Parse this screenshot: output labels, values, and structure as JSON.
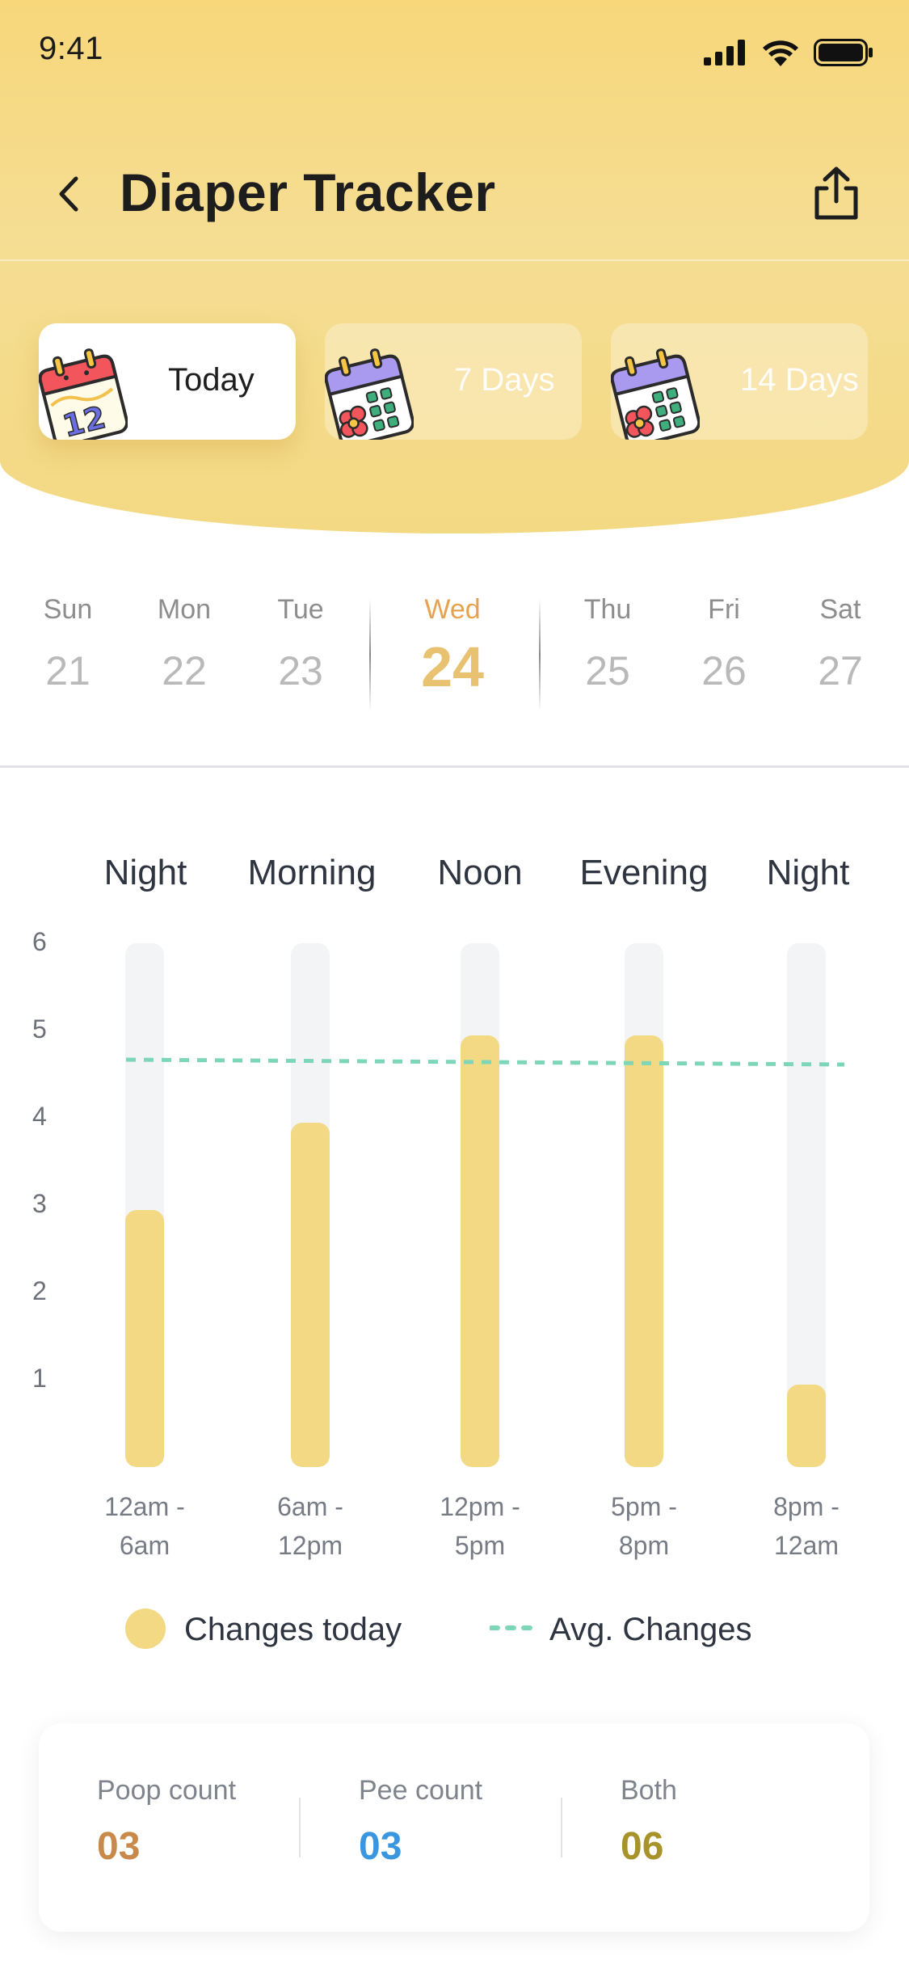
{
  "status_bar": {
    "time": "9:41",
    "icons": [
      "signal-icon",
      "wifi-icon",
      "battery-icon"
    ]
  },
  "header": {
    "title": "Diaper Tracker",
    "back_icon": "chevron-left-icon",
    "share_icon": "share-icon"
  },
  "range_tabs": [
    {
      "label": "Today",
      "active": true,
      "icon": "calendar-today-icon"
    },
    {
      "label": "7 Days",
      "active": false,
      "icon": "calendar-flower-icon"
    },
    {
      "label": "14 Days",
      "active": false,
      "icon": "calendar-flower-icon"
    }
  ],
  "week": [
    {
      "day": "Sun",
      "date": "21"
    },
    {
      "day": "Mon",
      "date": "22"
    },
    {
      "day": "Tue",
      "date": "23"
    },
    {
      "day": "Wed",
      "date": "24",
      "selected": true
    },
    {
      "day": "Thu",
      "date": "25"
    },
    {
      "day": "Fri",
      "date": "26"
    },
    {
      "day": "Sat",
      "date": "27"
    }
  ],
  "chart_data": {
    "type": "bar",
    "periods": [
      "Night",
      "Morning",
      "Noon",
      "Evening",
      "Night"
    ],
    "categories": [
      "12am - 6am",
      "6am - 12pm",
      "12pm - 5pm",
      "5pm - 8pm",
      "8pm - 12am"
    ],
    "series": [
      {
        "name": "Changes today",
        "values": [
          3,
          4,
          5,
          5,
          1
        ],
        "color": "#f3d983"
      }
    ],
    "avg_changes": 5,
    "avg_color": "#7ed6b9",
    "yticks": [
      1,
      2,
      3,
      4,
      5,
      6
    ],
    "ylim": [
      0,
      6
    ],
    "legend": [
      "Changes today",
      "Avg. Changes"
    ],
    "grid": false,
    "legend_position": "bottom"
  },
  "range_labels": [
    [
      "12am -",
      "6am"
    ],
    [
      "6am -",
      "12pm"
    ],
    [
      "12pm -",
      "5pm"
    ],
    [
      "5pm -",
      "8pm"
    ],
    [
      "8pm -",
      "12am"
    ]
  ],
  "legend": {
    "today": "Changes today",
    "avg": "Avg. Changes"
  },
  "stats": [
    {
      "label": "Poop count",
      "value": "03",
      "color": "#c8894a"
    },
    {
      "label": "Pee count",
      "value": "03",
      "color": "#3b96e0"
    },
    {
      "label": "Both",
      "value": "06",
      "color": "#a8922a"
    }
  ],
  "colors": {
    "accent": "#f3d983",
    "selected_day": "#e6a24e",
    "hero_bg": "#f6d886"
  }
}
